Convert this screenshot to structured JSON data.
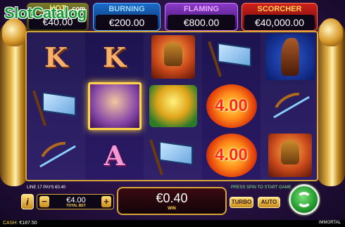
{
  "logo": {
    "text": "SlotCatalog",
    "suffix": ".com"
  },
  "jackpots": [
    {
      "name": "HOT",
      "value": "€40.00"
    },
    {
      "name": "BURNING",
      "value": "€200.00"
    },
    {
      "name": "FLAMING",
      "value": "€800.00"
    },
    {
      "name": "SCORCHER",
      "value": "€40,000.00"
    }
  ],
  "reels": [
    [
      "K",
      "flag",
      "bow"
    ],
    [
      "K",
      "princess",
      "A"
    ],
    [
      "warrior",
      "gold",
      "flag"
    ],
    [
      "flag",
      "4.00",
      "4.00"
    ],
    [
      "horse",
      "bow",
      "warrior"
    ]
  ],
  "fire_value": "4.00",
  "bottom": {
    "line_info": "LINE 17 PAYS €0.40",
    "press_info": "PRESS SPIN TO START GAME",
    "info_label": "i",
    "minus_label": "−",
    "plus_label": "+",
    "bet_value": "€4.00",
    "bet_label": "TOTAL BET",
    "win_value": "€0.40",
    "win_label": "WIN",
    "turbo_label": "TURBO",
    "auto_label": "AUTO",
    "cash_label": "CASH:",
    "cash_value": "€187.50",
    "brand": "IMMORTAL"
  }
}
